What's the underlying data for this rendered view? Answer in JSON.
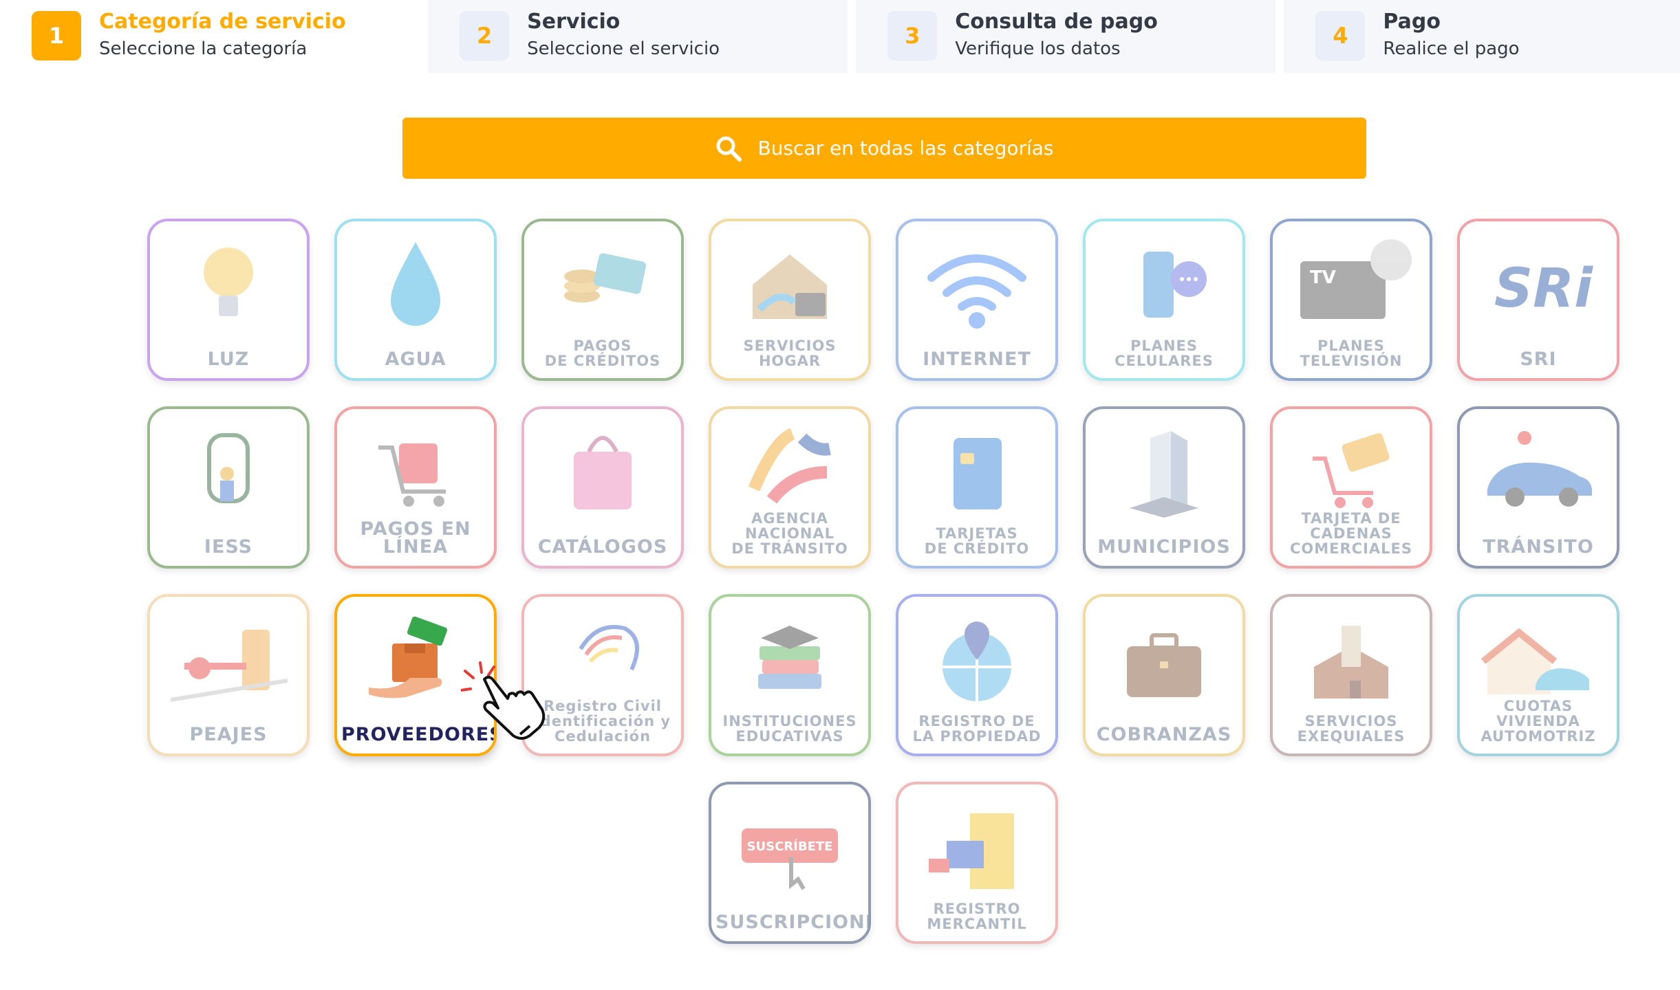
{
  "steps": [
    {
      "number": "1",
      "title": "Categoría de servicio",
      "subtitle": "Seleccione la categoría",
      "active": true
    },
    {
      "number": "2",
      "title": "Servicio",
      "subtitle": "Seleccione el servicio",
      "active": false
    },
    {
      "number": "3",
      "title": "Consulta de pago",
      "subtitle": "Verifique los datos",
      "active": false
    },
    {
      "number": "4",
      "title": "Pago",
      "subtitle": "Realice el pago",
      "active": false
    }
  ],
  "search": {
    "placeholder": "Buscar en todas las categorías",
    "icon": "search-icon"
  },
  "categories": [
    {
      "label": "LUZ",
      "icon": "lightbulb-icon",
      "border": "#c9a3ee"
    },
    {
      "label": "AGUA",
      "icon": "water-drop-icon",
      "border": "#9fe0f0"
    },
    {
      "label": "PAGOS\nDE CRÉDITOS",
      "icon": "coins-card-icon",
      "border": "#9bb98f"
    },
    {
      "label": "SERVICIOS\nHOGAR",
      "icon": "home-services-icon",
      "border": "#f2dba3"
    },
    {
      "label": "INTERNET",
      "icon": "wifi-icon",
      "border": "#a7c0ea"
    },
    {
      "label": "PLANES\nCELULARES",
      "icon": "cellphone-icon",
      "border": "#a3e8ef"
    },
    {
      "label": "PLANES\nTELEVISIÓN",
      "icon": "tv-dish-icon",
      "border": "#8fa7cf"
    },
    {
      "label": "SRI",
      "icon": "sri-logo-icon",
      "border": "#f0a3a8"
    },
    {
      "label": "IESS",
      "icon": "iess-logo-icon",
      "border": "#9bb98f"
    },
    {
      "label": "PAGOS EN LÍNEA",
      "icon": "shopping-cart-icon",
      "border": "#f2a3a3"
    },
    {
      "label": "CATÁLOGOS",
      "icon": "shopping-bag-icon",
      "border": "#e8b4cf"
    },
    {
      "label": "AGENCIA\nNACIONAL\nDE TRÁNSITO",
      "icon": "ant-logo-icon",
      "border": "#f2d9a3"
    },
    {
      "label": "TARJETAS\nDE CRÉDITO",
      "icon": "credit-card-icon",
      "border": "#a7c0ea"
    },
    {
      "label": "MUNICIPIOS",
      "icon": "building-icon",
      "border": "#9aa2b6"
    },
    {
      "label": "TARJETA DE\nCADENAS COMERCIALES",
      "icon": "cart-card-icon",
      "border": "#f2a3a3"
    },
    {
      "label": "TRÁNSITO",
      "icon": "car-icon",
      "border": "#8f9ab0"
    },
    {
      "label": "PEAJES",
      "icon": "toll-booth-icon",
      "border": "#f7dcb8"
    },
    {
      "label": "PROVEEDORES",
      "icon": "delivery-box-icon",
      "border": "#ffab00"
    },
    {
      "label": "Registro Civil\nIdentificación y Cedulación",
      "icon": "registro-civil-logo-icon",
      "border": "#f2b7b7"
    },
    {
      "label": "INSTITUCIONES\nEDUCATIVAS",
      "icon": "books-icon",
      "border": "#a9d39a"
    },
    {
      "label": "REGISTRO DE\nLA PROPIEDAD",
      "icon": "globe-pin-icon",
      "border": "#a7b0ea"
    },
    {
      "label": "COBRANZAS",
      "icon": "briefcase-icon",
      "border": "#f2dba3"
    },
    {
      "label": "SERVICIOS\nEXEQUIALES",
      "icon": "church-icon",
      "border": "#c9b7b7"
    },
    {
      "label": "CUOTAS VIVIENDA\nAUTOMOTRIZ",
      "icon": "house-car-icon",
      "border": "#a3d3df"
    },
    {
      "label": "SUSCRIPCIONES",
      "icon": "subscribe-button-icon",
      "border": "#8f9ab0",
      "badge": "SUSCRÍBETE"
    },
    {
      "label": "REGISTRO\nMERCANTIL",
      "icon": "registro-mercantil-logo-icon",
      "border": "#f2b7b7"
    }
  ],
  "highlighted_index": 17,
  "colors": {
    "accent": "#ffab00",
    "highlight_label": "#23235f",
    "muted_label": "#7d8ba1"
  }
}
